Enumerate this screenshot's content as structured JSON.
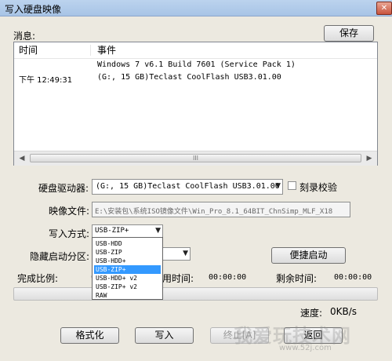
{
  "window": {
    "title": "写入硬盘映像",
    "close_glyph": "✕"
  },
  "log": {
    "label": "消息:",
    "save_button": "保存",
    "columns": [
      "时间",
      "事件"
    ],
    "rows": [
      {
        "time": "",
        "event": "Windows 7 v6.1 Build 7601 (Service Pack 1)"
      },
      {
        "time": "下午 12:49:31",
        "event": "(G:, 15 GB)Teclast CoolFlash USB3.01.00"
      }
    ],
    "scroll_left": "◀",
    "scroll_right": "▶",
    "scroll_grip": "III"
  },
  "drive": {
    "label": "硬盘驱动器:",
    "value": "(G:, 15 GB)Teclast CoolFlash USB3.01.00",
    "verify_label": "刻录校验"
  },
  "image_file": {
    "label": "映像文件:",
    "value": "E:\\安装包\\系统ISO镜像文件\\Win_Pro_8.1_64BIT_ChnSimp_MLF_X18"
  },
  "write_method": {
    "label": "写入方式:",
    "selected": "USB-ZIP+",
    "options": [
      "USB-HDD",
      "USB-ZIP",
      "USB-HDD+",
      "USB-ZIP+",
      "USB-HDD+ v2",
      "USB-ZIP+ v2",
      "RAW"
    ],
    "highlighted_index": 3
  },
  "hidden_partition": {
    "label": "隐藏启动分区:"
  },
  "quick_boot_button": "便捷启动",
  "progress": {
    "complete_label": "完成比例:",
    "complete_value": "0",
    "elapsed_label": "用时间:",
    "elapsed_value": "00:00:00",
    "remaining_label": "剩余时间:",
    "remaining_value": "00:00:00",
    "fraction": 0
  },
  "speed": {
    "label": "速度:",
    "value": "0KB/s"
  },
  "actions": {
    "format": "格式化",
    "write": "写入",
    "abort": "终止[A]",
    "back": "返回"
  },
  "watermark": {
    "text": "我爱玩技术网",
    "url": "www.52j.com"
  },
  "icons": {
    "dropdown": "chevron-down-icon",
    "close": "close-icon",
    "scroll_left": "scroll-left-icon",
    "scroll_right": "scroll-right-icon"
  }
}
